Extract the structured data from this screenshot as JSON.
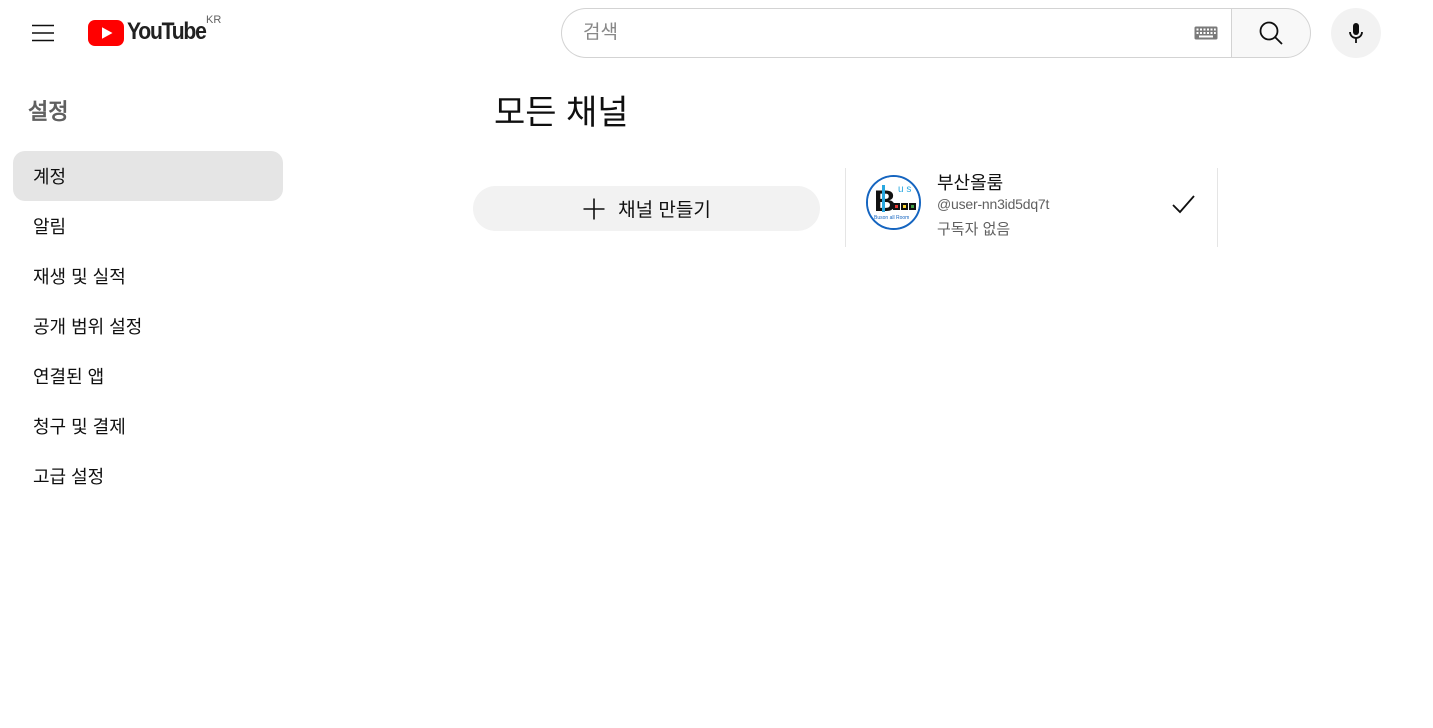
{
  "header": {
    "logo_text": "YouTube",
    "country_code": "KR",
    "search_placeholder": "검색",
    "icons": {
      "menu": "hamburger-menu-icon",
      "logo": "youtube-logo",
      "keyboard": "keyboard-icon",
      "search": "search-icon",
      "mic": "microphone-icon"
    }
  },
  "sidebar": {
    "title": "설정",
    "items": [
      {
        "label": "계정",
        "active": true
      },
      {
        "label": "알림",
        "active": false
      },
      {
        "label": "재생 및 실적",
        "active": false
      },
      {
        "label": "공개 범위 설정",
        "active": false
      },
      {
        "label": "연결된 앱",
        "active": false
      },
      {
        "label": "청구 및 결제",
        "active": false
      },
      {
        "label": "고급 설정",
        "active": false
      }
    ]
  },
  "main": {
    "title": "모든 채널",
    "create_button_label": "채널 만들기",
    "channels": [
      {
        "name": "부산올룸",
        "handle": "@user-nn3id5dq7t",
        "subscribers": "구독자 없음",
        "selected": true
      }
    ]
  },
  "colors": {
    "brand_red": "#ff0000",
    "active_bg": "#e5e5e5",
    "button_bg": "#f2f2f2",
    "secondary_text": "#606060"
  }
}
